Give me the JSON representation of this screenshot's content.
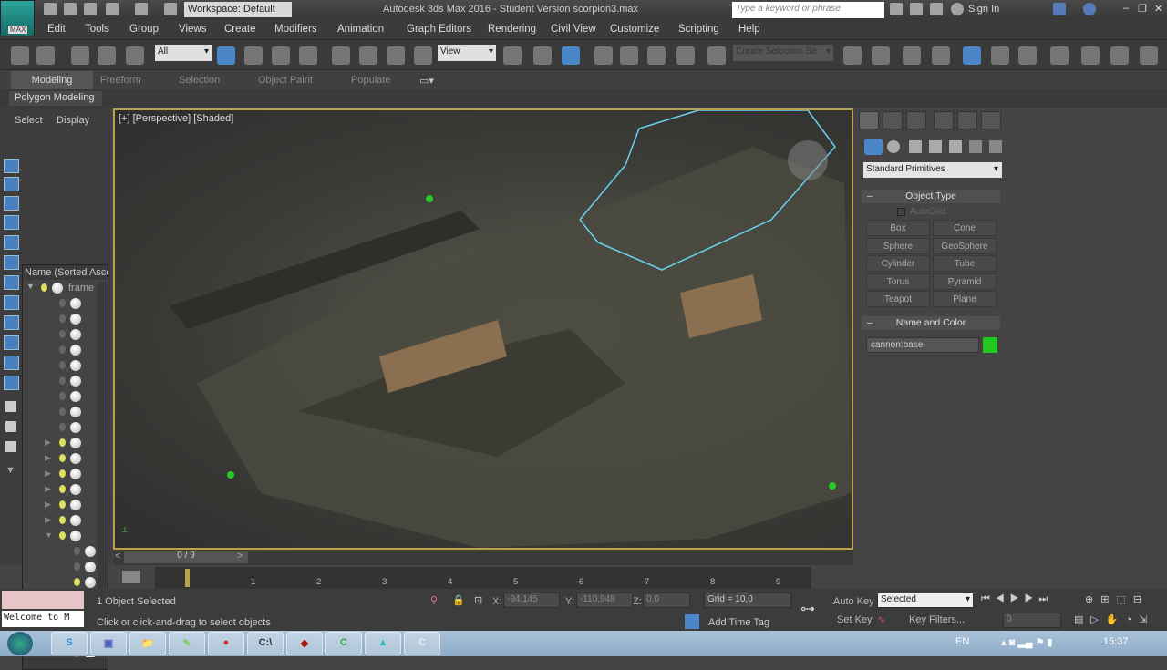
{
  "title_bar": {
    "logo_label": "MAX",
    "workspace": "Workspace: Default",
    "window_title": "Autodesk 3ds Max 2016 - Student Version   scorpion3.max",
    "search_placeholder": "Type a keyword or phrase",
    "sign_in": "Sign In"
  },
  "menu": [
    "Edit",
    "Tools",
    "Group",
    "Views",
    "Create",
    "Modifiers",
    "Animation",
    "Graph Editors",
    "Rendering",
    "Civil View",
    "Customize",
    "Scripting",
    "Help"
  ],
  "toolbar": {
    "filter": "All",
    "ref_coord": "View",
    "selection_set": "Create Selection Se"
  },
  "ribbon": {
    "tabs": [
      "Modeling",
      "Freeform",
      "Selection",
      "Object Paint",
      "Populate"
    ],
    "sub": "Polygon Modeling"
  },
  "scene_explorer": {
    "tabs": [
      "Select",
      "Display"
    ],
    "column": "Name (Sorted Ascending)",
    "root": "frame"
  },
  "viewport": {
    "label": "[+] [Perspective] [Shaded]",
    "border_color": "#b8a24a"
  },
  "command_panel": {
    "category": "Standard Primitives",
    "object_type": "Object Type",
    "autogrid": "AutoGrid",
    "buttons": [
      "Box",
      "Cone",
      "Sphere",
      "GeoSphere",
      "Cylinder",
      "Tube",
      "Torus",
      "Pyramid",
      "Teapot",
      "Plane"
    ],
    "name_and_color": "Name and Color",
    "object_name": "cannon:base",
    "object_color": "#22c722"
  },
  "timeline": {
    "slider": "0 / 9",
    "ticks": [
      "1",
      "2",
      "3",
      "4",
      "5",
      "6",
      "7",
      "8",
      "9"
    ]
  },
  "status": {
    "maxscript": "Welcome to M",
    "selected": "1 Object Selected",
    "prompt": "Click or click-and-drag to select objects",
    "x_label": "X:",
    "x": "-94,145",
    "y_label": "Y:",
    "y": "-110,948",
    "z_label": "Z:",
    "z": "0,0",
    "grid": "Grid = 10,0",
    "add_time_tag": "Add Time Tag",
    "auto_key": "Auto Key",
    "set_key": "Set Key",
    "key_mode": "Selected",
    "key_filters": "Key Filters...",
    "frame": "0"
  },
  "taskbar": {
    "apps": [
      "S",
      "▣",
      "📁",
      "✎",
      "●",
      "C:\\",
      "◆",
      "C",
      "▲",
      "C"
    ],
    "lang": "EN",
    "time": "15:37"
  }
}
